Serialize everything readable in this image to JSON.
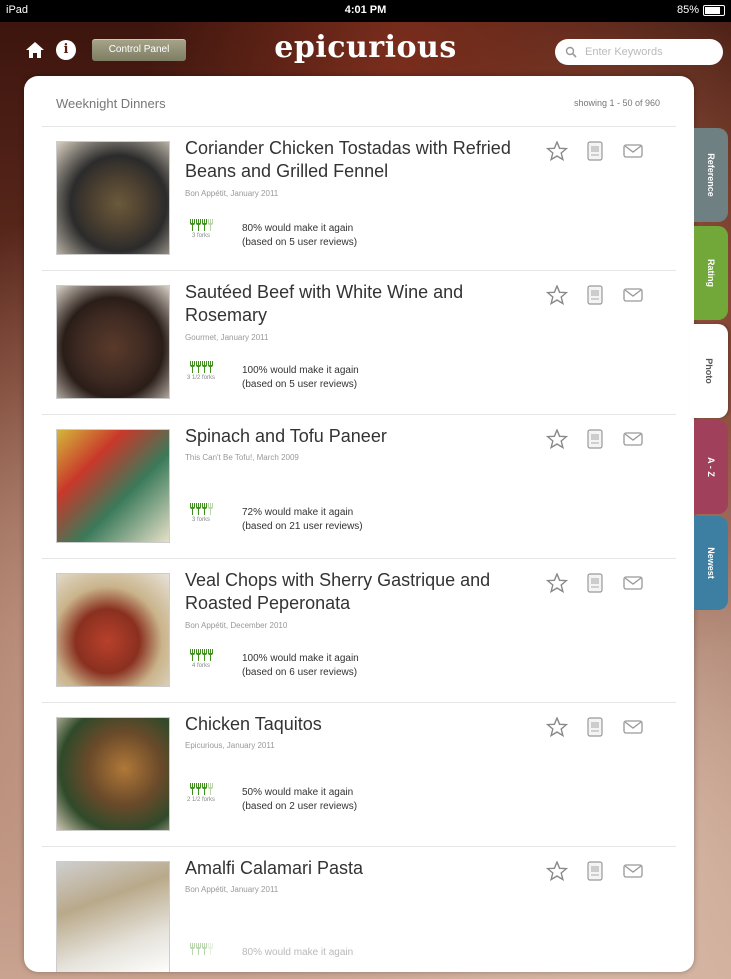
{
  "status_bar": {
    "device": "iPad",
    "time": "4:01 PM",
    "battery": "85%"
  },
  "header": {
    "control_panel_label": "Control Panel",
    "logo": "epicurious",
    "search_placeholder": "Enter Keywords"
  },
  "panel": {
    "title": "Weeknight Dinners",
    "count": "showing 1 - 50 of 960"
  },
  "tabs": [
    "Reference",
    "Rating",
    "Photo",
    "A - Z",
    "Newest"
  ],
  "selected_tab": "Photo",
  "recipes": [
    {
      "title": "Coriander Chicken Tostadas with Refried Beans and Grilled Fennel",
      "source": "Bon Appétit, January 2011",
      "forks": 3,
      "forks_label": "3 forks",
      "make_again": "80% would make it again",
      "reviews": "(based on 5 user reviews)"
    },
    {
      "title": "Sautéed Beef with White Wine and Rosemary",
      "source": "Gourmet, January 2011",
      "forks": 3.5,
      "forks_label": "3 1/2 forks",
      "make_again": "100% would make it again",
      "reviews": "(based on 5 user reviews)"
    },
    {
      "title": "Spinach and Tofu Paneer",
      "source": "This Can't Be Tofu!, March 2009",
      "forks": 3,
      "forks_label": "3 forks",
      "make_again": "72% would make it again",
      "reviews": "(based on 21 user reviews)"
    },
    {
      "title": "Veal Chops with Sherry Gastrique and Roasted Peperonata",
      "source": "Bon Appétit, December 2010",
      "forks": 4,
      "forks_label": "4 forks",
      "make_again": "100% would make it again",
      "reviews": "(based on 6 user reviews)"
    },
    {
      "title": "Chicken Taquitos",
      "source": "Epicurious, January 2011",
      "forks": 2.5,
      "forks_label": "2 1/2 forks",
      "make_again": "50% would make it again",
      "reviews": "(based on 2 user reviews)"
    },
    {
      "title": "Amalfi Calamari Pasta",
      "source": "Bon Appétit, January 2011",
      "forks": 3,
      "forks_label": "",
      "make_again": "80% would make it again",
      "reviews": ""
    }
  ],
  "colors": {
    "fork_green": "#3f8f1f",
    "header_bg": "#3a130c",
    "tab_reference": "#6f8083",
    "tab_rating": "#72a83a",
    "tab_az": "#a0405a",
    "tab_newest": "#3d7fa2"
  }
}
